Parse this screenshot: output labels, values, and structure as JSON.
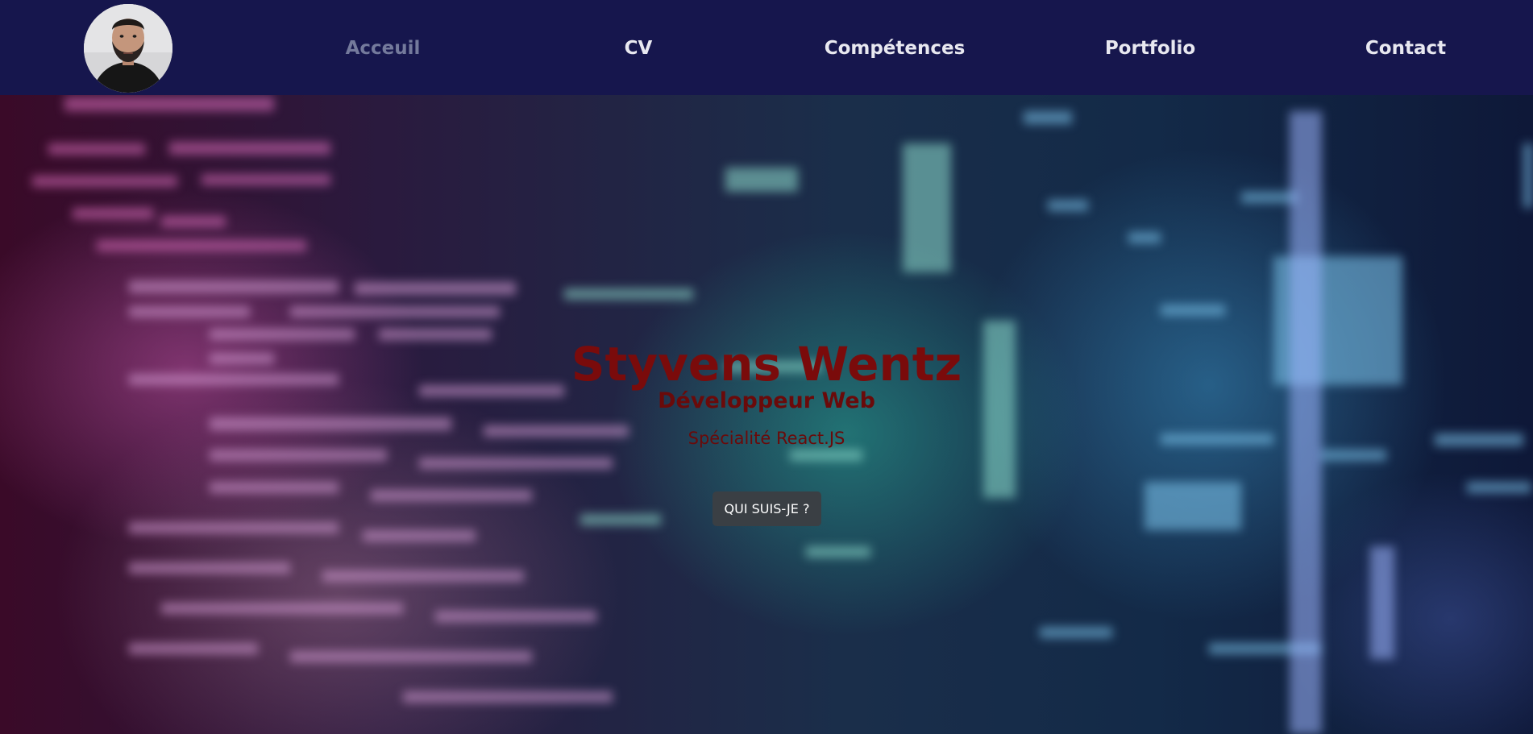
{
  "navbar": {
    "avatar_alt": "Styvens Wentz",
    "links": [
      {
        "label": "Acceuil",
        "active": true
      },
      {
        "label": "CV",
        "active": false
      },
      {
        "label": "Compétences",
        "active": false
      },
      {
        "label": "Portfolio",
        "active": false
      },
      {
        "label": "Contact",
        "active": false
      }
    ]
  },
  "hero": {
    "title": "Styvens Wentz",
    "subtitle": "Développeur Web",
    "specialty": "Spécialité React.JS",
    "button_label": "QUI SUIS-JE ?"
  },
  "colors": {
    "navbar_bg": "#16164d",
    "nav_active": "#747a9c",
    "nav_text": "#e8e8f0",
    "title": "#7a0b0b",
    "button_bg": "#3a3f44"
  },
  "icons": {
    "avatar": "profile-photo"
  }
}
